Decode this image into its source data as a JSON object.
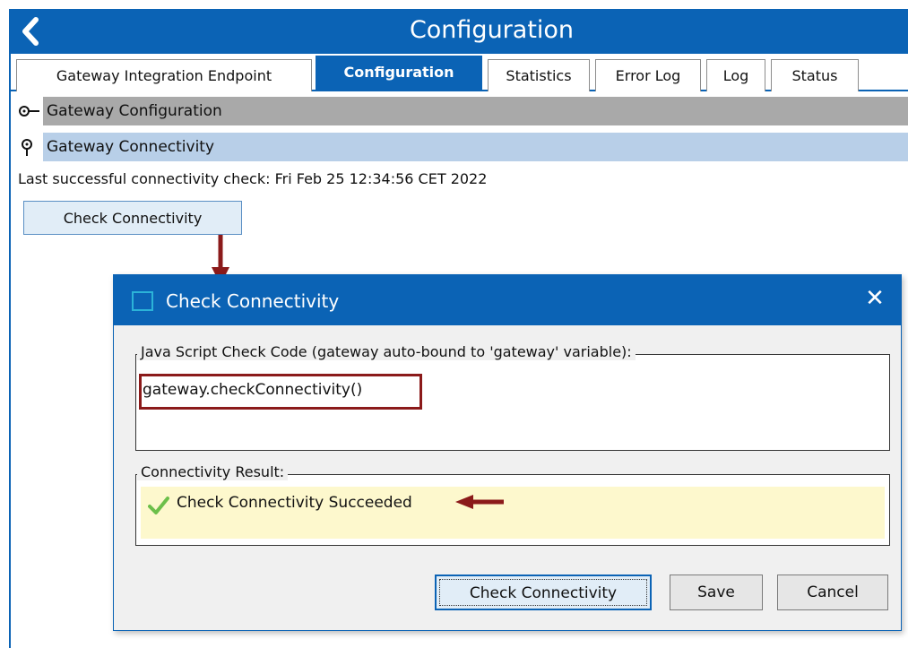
{
  "header": {
    "title": "Configuration",
    "back_icon": "chevron-left-icon"
  },
  "tabs": [
    {
      "label": "Gateway Integration Endpoint",
      "active": false
    },
    {
      "label": "Configuration",
      "active": true
    },
    {
      "label": "Statistics",
      "active": false
    },
    {
      "label": "Error Log",
      "active": false
    },
    {
      "label": "Log",
      "active": false
    },
    {
      "label": "Status",
      "active": false
    }
  ],
  "sections": {
    "gateway_configuration": {
      "label": "Gateway Configuration",
      "icon": "key-icon"
    },
    "gateway_connectivity": {
      "label": "Gateway Connectivity",
      "icon": "pin-icon"
    }
  },
  "last_check": "Last successful connectivity check: Fri Feb 25 12:34:56 CET 2022",
  "main_button": "Check Connectivity",
  "dialog": {
    "title": "Check Connectivity",
    "close": "✕",
    "code_group_label": "Java Script Check Code (gateway auto-bound to 'gateway' variable):",
    "code_value": "gateway.checkConnectivity()",
    "result_group_label": "Connectivity Result:",
    "result_text": "Check Connectivity Succeeded",
    "buttons": {
      "check": "Check Connectivity",
      "save": "Save",
      "cancel": "Cancel"
    }
  },
  "colors": {
    "accent": "#0b63b5",
    "annotation": "#8b1a1a",
    "success": "#6cbf4a",
    "result_bg": "#fdf8cd"
  }
}
